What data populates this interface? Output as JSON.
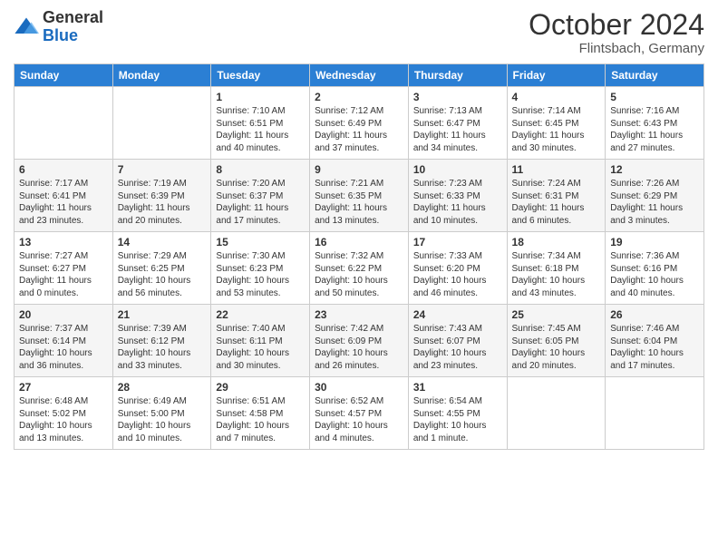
{
  "logo": {
    "general": "General",
    "blue": "Blue"
  },
  "header": {
    "month": "October 2024",
    "location": "Flintsbach, Germany"
  },
  "weekdays": [
    "Sunday",
    "Monday",
    "Tuesday",
    "Wednesday",
    "Thursday",
    "Friday",
    "Saturday"
  ],
  "weeks": [
    [
      {
        "day": "",
        "info": ""
      },
      {
        "day": "",
        "info": ""
      },
      {
        "day": "1",
        "info": "Sunrise: 7:10 AM\nSunset: 6:51 PM\nDaylight: 11 hours and 40 minutes."
      },
      {
        "day": "2",
        "info": "Sunrise: 7:12 AM\nSunset: 6:49 PM\nDaylight: 11 hours and 37 minutes."
      },
      {
        "day": "3",
        "info": "Sunrise: 7:13 AM\nSunset: 6:47 PM\nDaylight: 11 hours and 34 minutes."
      },
      {
        "day": "4",
        "info": "Sunrise: 7:14 AM\nSunset: 6:45 PM\nDaylight: 11 hours and 30 minutes."
      },
      {
        "day": "5",
        "info": "Sunrise: 7:16 AM\nSunset: 6:43 PM\nDaylight: 11 hours and 27 minutes."
      }
    ],
    [
      {
        "day": "6",
        "info": "Sunrise: 7:17 AM\nSunset: 6:41 PM\nDaylight: 11 hours and 23 minutes."
      },
      {
        "day": "7",
        "info": "Sunrise: 7:19 AM\nSunset: 6:39 PM\nDaylight: 11 hours and 20 minutes."
      },
      {
        "day": "8",
        "info": "Sunrise: 7:20 AM\nSunset: 6:37 PM\nDaylight: 11 hours and 17 minutes."
      },
      {
        "day": "9",
        "info": "Sunrise: 7:21 AM\nSunset: 6:35 PM\nDaylight: 11 hours and 13 minutes."
      },
      {
        "day": "10",
        "info": "Sunrise: 7:23 AM\nSunset: 6:33 PM\nDaylight: 11 hours and 10 minutes."
      },
      {
        "day": "11",
        "info": "Sunrise: 7:24 AM\nSunset: 6:31 PM\nDaylight: 11 hours and 6 minutes."
      },
      {
        "day": "12",
        "info": "Sunrise: 7:26 AM\nSunset: 6:29 PM\nDaylight: 11 hours and 3 minutes."
      }
    ],
    [
      {
        "day": "13",
        "info": "Sunrise: 7:27 AM\nSunset: 6:27 PM\nDaylight: 11 hours and 0 minutes."
      },
      {
        "day": "14",
        "info": "Sunrise: 7:29 AM\nSunset: 6:25 PM\nDaylight: 10 hours and 56 minutes."
      },
      {
        "day": "15",
        "info": "Sunrise: 7:30 AM\nSunset: 6:23 PM\nDaylight: 10 hours and 53 minutes."
      },
      {
        "day": "16",
        "info": "Sunrise: 7:32 AM\nSunset: 6:22 PM\nDaylight: 10 hours and 50 minutes."
      },
      {
        "day": "17",
        "info": "Sunrise: 7:33 AM\nSunset: 6:20 PM\nDaylight: 10 hours and 46 minutes."
      },
      {
        "day": "18",
        "info": "Sunrise: 7:34 AM\nSunset: 6:18 PM\nDaylight: 10 hours and 43 minutes."
      },
      {
        "day": "19",
        "info": "Sunrise: 7:36 AM\nSunset: 6:16 PM\nDaylight: 10 hours and 40 minutes."
      }
    ],
    [
      {
        "day": "20",
        "info": "Sunrise: 7:37 AM\nSunset: 6:14 PM\nDaylight: 10 hours and 36 minutes."
      },
      {
        "day": "21",
        "info": "Sunrise: 7:39 AM\nSunset: 6:12 PM\nDaylight: 10 hours and 33 minutes."
      },
      {
        "day": "22",
        "info": "Sunrise: 7:40 AM\nSunset: 6:11 PM\nDaylight: 10 hours and 30 minutes."
      },
      {
        "day": "23",
        "info": "Sunrise: 7:42 AM\nSunset: 6:09 PM\nDaylight: 10 hours and 26 minutes."
      },
      {
        "day": "24",
        "info": "Sunrise: 7:43 AM\nSunset: 6:07 PM\nDaylight: 10 hours and 23 minutes."
      },
      {
        "day": "25",
        "info": "Sunrise: 7:45 AM\nSunset: 6:05 PM\nDaylight: 10 hours and 20 minutes."
      },
      {
        "day": "26",
        "info": "Sunrise: 7:46 AM\nSunset: 6:04 PM\nDaylight: 10 hours and 17 minutes."
      }
    ],
    [
      {
        "day": "27",
        "info": "Sunrise: 6:48 AM\nSunset: 5:02 PM\nDaylight: 10 hours and 13 minutes."
      },
      {
        "day": "28",
        "info": "Sunrise: 6:49 AM\nSunset: 5:00 PM\nDaylight: 10 hours and 10 minutes."
      },
      {
        "day": "29",
        "info": "Sunrise: 6:51 AM\nSunset: 4:58 PM\nDaylight: 10 hours and 7 minutes."
      },
      {
        "day": "30",
        "info": "Sunrise: 6:52 AM\nSunset: 4:57 PM\nDaylight: 10 hours and 4 minutes."
      },
      {
        "day": "31",
        "info": "Sunrise: 6:54 AM\nSunset: 4:55 PM\nDaylight: 10 hours and 1 minute."
      },
      {
        "day": "",
        "info": ""
      },
      {
        "day": "",
        "info": ""
      }
    ]
  ]
}
